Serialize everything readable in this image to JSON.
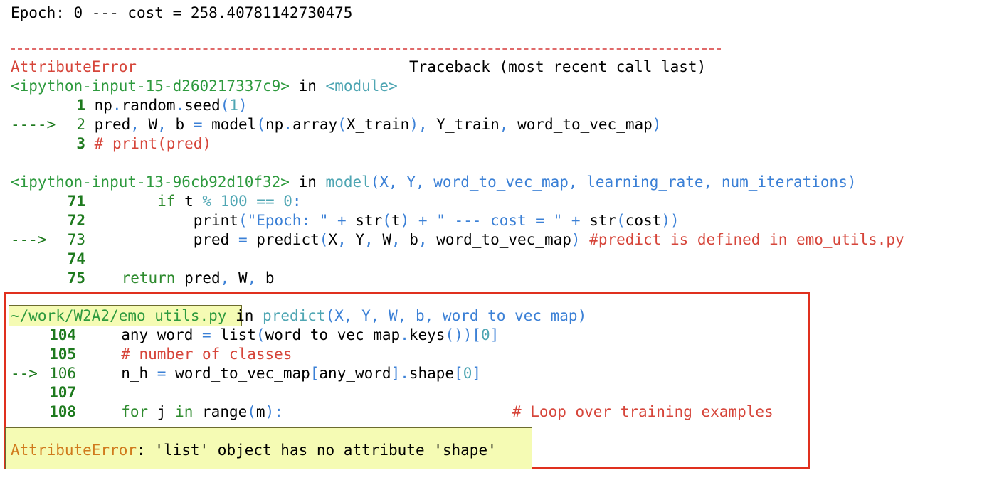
{
  "top_line": "Epoch: 0 --- cost = 258.40781142730475",
  "separator": "---------------------------------------------------------------------------",
  "error_type": "AttributeError",
  "traceback_header": "Traceback (most recent call last)",
  "frame1": {
    "file": "<ipython-input-15-d260217337c9>",
    "in_word": "in",
    "scope": "<module>",
    "lines": [
      {
        "marker": "",
        "num": "1",
        "code": "np.random.seed(1)"
      },
      {
        "marker": "---->",
        "num": "2",
        "code": "pred, W, b = model(np.array(X_train), Y_train, word_to_vec_map)"
      },
      {
        "marker": "",
        "num": "3",
        "code": "# print(pred)"
      }
    ]
  },
  "frame2": {
    "file": "<ipython-input-13-96cb92d10f32>",
    "in_word": "in",
    "scope": "model(X, Y, word_to_vec_map, learning_rate, num_iterations)",
    "lines": [
      {
        "marker": "",
        "num": "71",
        "code": "if t % 100 == 0:"
      },
      {
        "marker": "",
        "num": "72",
        "code": "print(\"Epoch: \" + str(t) + \" --- cost = \" + str(cost))"
      },
      {
        "marker": "--->",
        "num": "73",
        "code": "pred = predict(X, Y, W, b, word_to_vec_map)",
        "comment": "#predict is defined in emo_utils.py"
      },
      {
        "marker": "",
        "num": "74",
        "code": ""
      },
      {
        "marker": "",
        "num": "75",
        "code": "return pred, W, b"
      }
    ]
  },
  "frame3": {
    "file": "~/work/W2A2/emo_utils.py",
    "in_word": "in",
    "scope": "predict(X, Y, W, b, word_to_vec_map)",
    "lines": [
      {
        "marker": "",
        "num": "104",
        "code": "any_word = list(word_to_vec_map.keys())[0]"
      },
      {
        "marker": "",
        "num": "105",
        "code": "# number of classes"
      },
      {
        "marker": "-->",
        "num": "106",
        "code": "n_h = word_to_vec_map[any_word].shape[0]"
      },
      {
        "marker": "",
        "num": "107",
        "code": ""
      },
      {
        "marker": "",
        "num": "108",
        "code": "for j in range(m):",
        "comment": "# Loop over training examples"
      }
    ]
  },
  "final_error": {
    "type": "AttributeError",
    "message": ": 'list' object has no attribute 'shape'"
  },
  "colors": {
    "highlight_border": "#e0301e",
    "highlight_fill": "#f5fbb4",
    "error_red": "#d6453a",
    "line_number_green": "#1e7a1e"
  }
}
